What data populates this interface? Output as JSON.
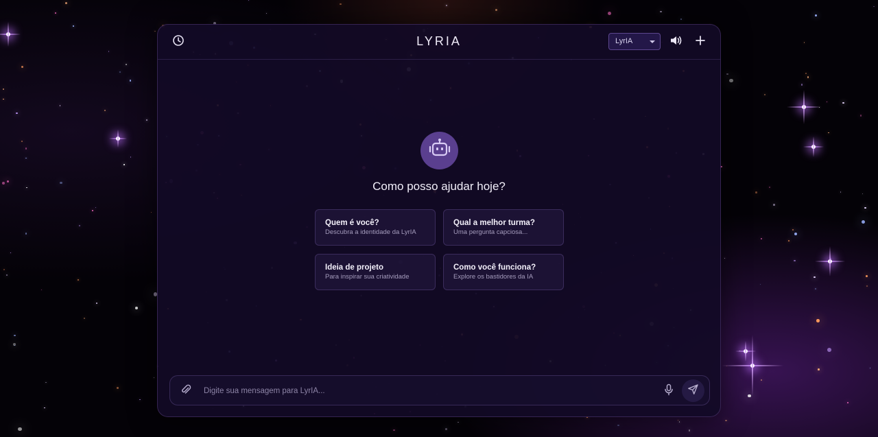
{
  "header": {
    "brand": "LYRIA",
    "model_select": {
      "selected": "LyrIA"
    },
    "icons": {
      "history": "clock-icon",
      "sound": "speaker-icon",
      "new_chat": "plus-icon"
    }
  },
  "welcome": {
    "avatar_icon": "robot-icon",
    "greeting": "Como posso ajudar hoje?"
  },
  "suggestions": [
    {
      "title": "Quem é você?",
      "subtitle": "Descubra a identidade da LyrIA"
    },
    {
      "title": "Qual a melhor turma?",
      "subtitle": "Uma pergunta capciosa..."
    },
    {
      "title": "Ideia de projeto",
      "subtitle": "Para inspirar sua criatividade"
    },
    {
      "title": "Como você funciona?",
      "subtitle": "Explore os bastidores da IA"
    }
  ],
  "composer": {
    "placeholder": "Digite sua mensagem para LyrIA...",
    "value": "",
    "icons": {
      "attach": "paperclip-icon",
      "mic": "microphone-icon",
      "send": "send-icon"
    }
  },
  "colors": {
    "panel_bg": "#120a26",
    "accent": "#5a3f8f",
    "text": "#f1eef9",
    "muted": "#a59cbd"
  }
}
